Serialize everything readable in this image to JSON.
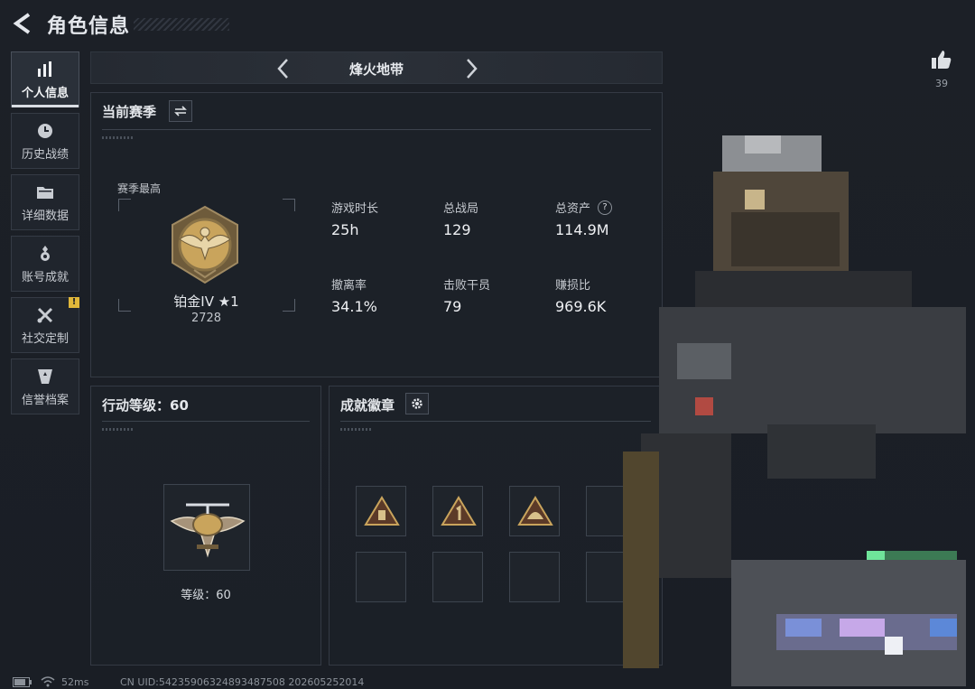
{
  "header": {
    "title": "角色信息"
  },
  "sidebar": {
    "items": [
      {
        "label": "个人信息",
        "active": true
      },
      {
        "label": "历史战绩"
      },
      {
        "label": "详细数据"
      },
      {
        "label": "账号成就"
      },
      {
        "label": "社交定制",
        "badge": "!"
      },
      {
        "label": "信誉档案"
      }
    ]
  },
  "mode": {
    "name": "烽火地带"
  },
  "season": {
    "title": "当前赛季",
    "best_label": "赛季最高",
    "rank_name": "铂金IV ★1",
    "rank_points": "2728",
    "stats": [
      {
        "label": "游戏时长",
        "value": "25h"
      },
      {
        "label": "总战局",
        "value": "129"
      },
      {
        "label": "总资产",
        "value": "114.9M",
        "help": "?"
      },
      {
        "label": "撤离率",
        "value": "34.1%"
      },
      {
        "label": "击败干员",
        "value": "79"
      },
      {
        "label": "赚损比",
        "value": "969.6K"
      }
    ]
  },
  "level": {
    "title": "行动等级：60",
    "caption": "等级：60"
  },
  "achievements": {
    "title": "成就徽章"
  },
  "like": {
    "count": "39"
  },
  "footer": {
    "ping": "52ms",
    "uid": "CN UID:54235906324893487508 202605252014"
  },
  "colors": {
    "accent_gold": "#c9a45c",
    "badge_yellow": "#e0b73a",
    "background": "#1b1f26"
  }
}
